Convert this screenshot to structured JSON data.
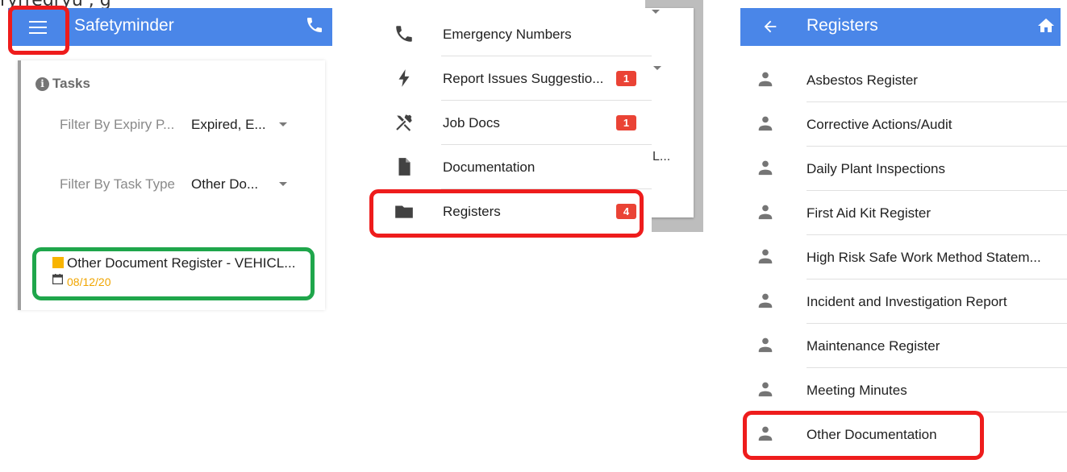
{
  "top_residue_text": "ryrregryu                                                              ,                              g",
  "panel1": {
    "app_title": "Safetyminder",
    "tasks_label": "Tasks",
    "filters": [
      {
        "label": "Filter By Expiry P...",
        "value": "Expired, E..."
      },
      {
        "label": "Filter By Task Type",
        "value": "Other Do..."
      }
    ],
    "task": {
      "title": "Other Document Register - VEHICL...",
      "date": "08/12/20"
    },
    "colors": {
      "appbar": "#4a86e8",
      "highlight_menu": "#ee1c1c",
      "highlight_task": "#1fa64b",
      "task_status": "#f8b400"
    }
  },
  "panel2": {
    "menu": [
      {
        "icon": "phone-icon",
        "label": "Emergency Numbers",
        "badge": ""
      },
      {
        "icon": "flash-icon",
        "label": "Report Issues Suggestio...",
        "badge": "1"
      },
      {
        "icon": "tools-icon",
        "label": "Job Docs",
        "badge": "1"
      },
      {
        "icon": "file-icon",
        "label": "Documentation",
        "badge": ""
      },
      {
        "icon": "folder-icon",
        "label": "Registers",
        "badge": "4"
      }
    ],
    "background_truncated_text": "L...",
    "colors": {
      "badge": "#ea4335",
      "highlight": "#ee1c1c"
    }
  },
  "panel3": {
    "app_title": "Registers",
    "items": [
      "Asbestos Register",
      "Corrective Actions/Audit",
      "Daily Plant Inspections",
      "First Aid Kit Register",
      "High Risk Safe Work Method Statem...",
      "Incident and Investigation Report",
      "Maintenance Register",
      "Meeting Minutes",
      "Other Documentation"
    ],
    "colors": {
      "appbar": "#4a86e8",
      "highlight": "#ee1c1c"
    }
  }
}
